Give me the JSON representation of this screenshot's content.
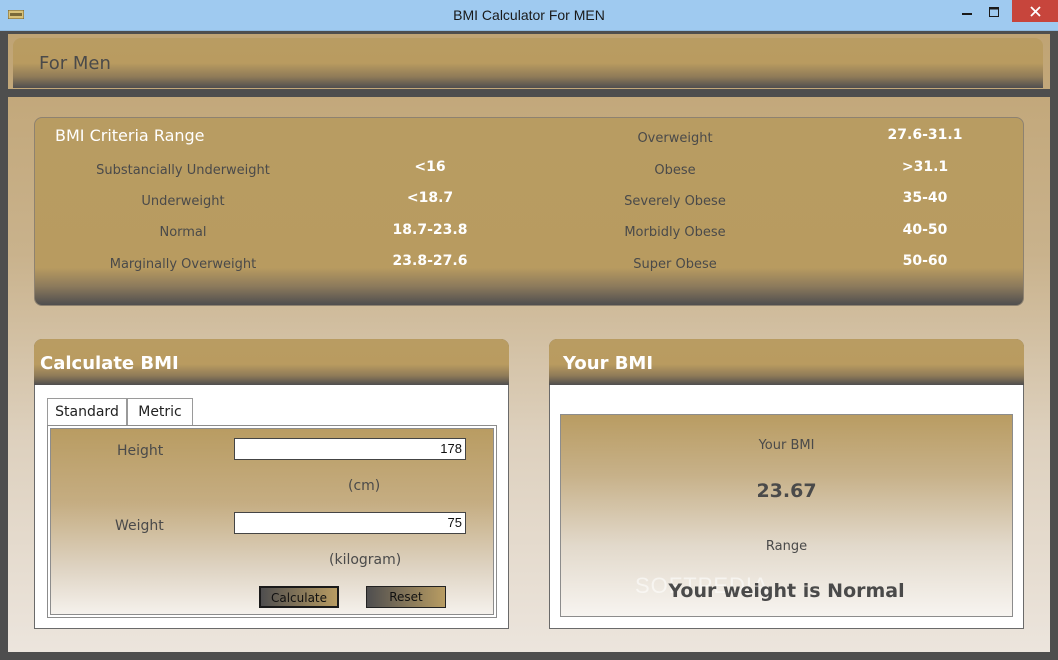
{
  "window": {
    "title": "BMI Calculator For MEN"
  },
  "header": {
    "title": "For Men"
  },
  "criteria": {
    "title": "BMI Criteria Range",
    "left": [
      {
        "label": "Substancially Underweight",
        "value": "<16"
      },
      {
        "label": "Underweight",
        "value": "<18.7"
      },
      {
        "label": "Normal",
        "value": "18.7-23.8"
      },
      {
        "label": "Marginally Overweight",
        "value": "23.8-27.6"
      }
    ],
    "right": [
      {
        "label": "Overweight",
        "value": "27.6-31.1"
      },
      {
        "label": "Obese",
        "value": ">31.1"
      },
      {
        "label": "Severely Obese",
        "value": "35-40"
      },
      {
        "label": "Morbidly Obese",
        "value": "40-50"
      },
      {
        "label": "Super Obese",
        "value": "50-60"
      }
    ]
  },
  "calculate": {
    "title": "Calculate BMI",
    "tabs": [
      {
        "label": "Standard",
        "selected": false
      },
      {
        "label": "Metric",
        "selected": true
      }
    ],
    "height_label": "Height",
    "height_value": "178",
    "height_unit": "(cm)",
    "weight_label": "Weight",
    "weight_value": "75",
    "weight_unit": "(kilogram)",
    "calculate_label": "Calculate",
    "reset_label": "Reset"
  },
  "your_bmi": {
    "title": "Your BMI",
    "bmi_label": "Your BMI",
    "bmi_value": "23.67",
    "range_label": "Range",
    "range_text": "Your weight is Normal",
    "watermark": "SOFTPEDIA"
  },
  "colors": {
    "gold": "#b89c62",
    "dark": "#4f4e4f",
    "titlebar": "#9fcaf0",
    "close": "#c7453c"
  }
}
